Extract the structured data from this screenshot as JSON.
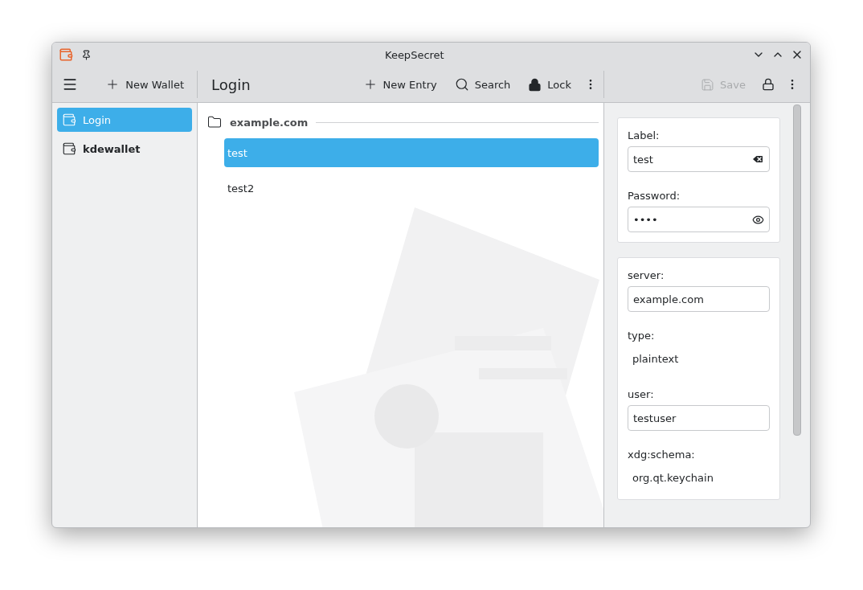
{
  "window": {
    "title": "KeepSecret"
  },
  "toolbar": {
    "new_wallet": "New Wallet",
    "page_title": "Login",
    "actions": [
      {
        "kind": "add",
        "label": "New Entry"
      },
      {
        "kind": "search",
        "label": "Search"
      },
      {
        "kind": "lock",
        "label": "Lock"
      }
    ],
    "save": {
      "label": "Save",
      "disabled": true
    }
  },
  "sidebar": {
    "items": [
      {
        "label": "Login",
        "selected": true,
        "default": false
      },
      {
        "label": "kdewallet",
        "selected": false,
        "default": true
      }
    ]
  },
  "entries": {
    "folder": "example.com",
    "items": [
      {
        "label": "test",
        "selected": true
      },
      {
        "label": "test2",
        "selected": false
      }
    ]
  },
  "details": {
    "cards": [
      {
        "fields": [
          {
            "label": "Label:",
            "value": "test",
            "kind": "input",
            "clear_button": true
          },
          {
            "label": "Password:",
            "value": "••••",
            "kind": "input",
            "reveal_button": true
          }
        ]
      },
      {
        "fields": [
          {
            "label": "server:",
            "value": "example.com",
            "kind": "input"
          },
          {
            "label": "type:",
            "value": "plaintext",
            "kind": "text"
          },
          {
            "label": "user:",
            "value": "testuser",
            "kind": "input"
          },
          {
            "label": "xdg:schema:",
            "value": "org.qt.keychain",
            "kind": "text"
          }
        ]
      }
    ]
  }
}
